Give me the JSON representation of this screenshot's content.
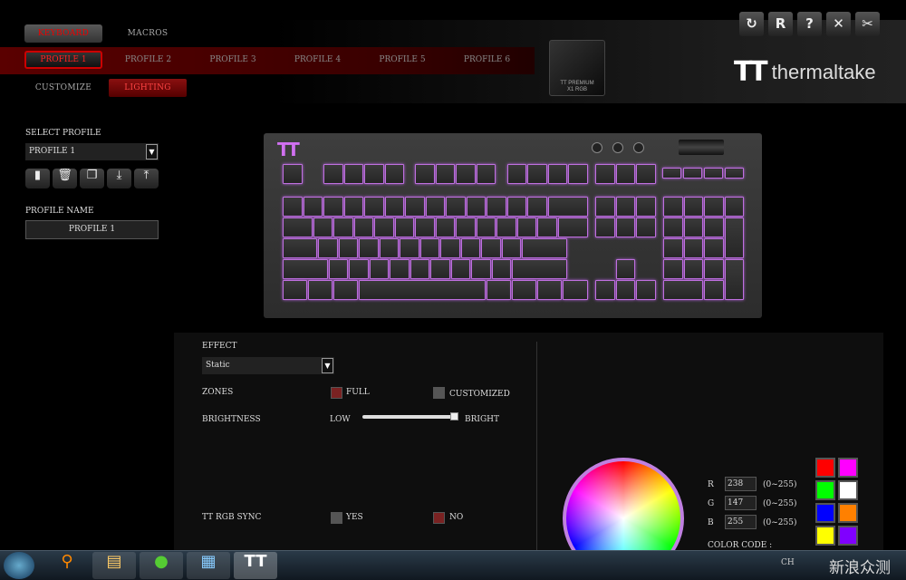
{
  "nav": {
    "tabs": [
      {
        "label": "KEYBOARD",
        "active": true
      },
      {
        "label": "MACROS"
      }
    ],
    "profiles": [
      "PROFILE 1",
      "PROFILE 2",
      "PROFILE 3",
      "PROFILE 4",
      "PROFILE 5",
      "PROFILE 6"
    ],
    "active_profile": "PROFILE 1",
    "subtabs": [
      {
        "label": "CUSTOMIZE"
      },
      {
        "label": "LIGHTING",
        "active": true
      }
    ]
  },
  "toolbar": {
    "icons": [
      "refresh-icon",
      "reset-icon",
      "help-icon",
      "close-icon",
      "tools-icon"
    ],
    "glyphs": [
      "↻",
      "R",
      "?",
      "✕",
      "✂"
    ]
  },
  "device": {
    "name": "TT PREMIUM X1 RGB"
  },
  "brand": {
    "name": "thermaltake"
  },
  "left": {
    "select_label": "SELECT PROFILE",
    "select_value": "PROFILE 1",
    "buttons": [
      "new-profile-icon",
      "delete-icon",
      "copy-icon",
      "import-icon",
      "export-icon"
    ],
    "name_label": "PROFILE NAME",
    "name_value": "PROFILE 1"
  },
  "lighting": {
    "effect_label": "EFFECT",
    "effect_value": "Static",
    "zones_label": "ZONES",
    "zone_full": "FULL",
    "zone_custom": "CUSTOMIZED",
    "zone_selected": "FULL",
    "brightness_label": "BRIGHTNESS",
    "low": "LOW",
    "high": "BRIGHT",
    "brightness_percent": 100,
    "sync_label": "TT RGB SYNC",
    "sync_yes": "YES",
    "sync_no": "NO",
    "sync_selected": "NO"
  },
  "color": {
    "r_label": "R",
    "g_label": "G",
    "b_label": "B",
    "r": "238",
    "g": "147",
    "b": "255",
    "range": "(0~255)",
    "code_label": "COLOR CODE :",
    "key_color": "#c070e0",
    "swatches": [
      "#ff0000",
      "#ff00ff",
      "#00ff00",
      "#ffffff",
      "#0000ff",
      "#ff8000",
      "#ffff00",
      "#8000ff"
    ]
  },
  "taskbar": {
    "lang": "CH",
    "watermark": "新浪众测"
  }
}
